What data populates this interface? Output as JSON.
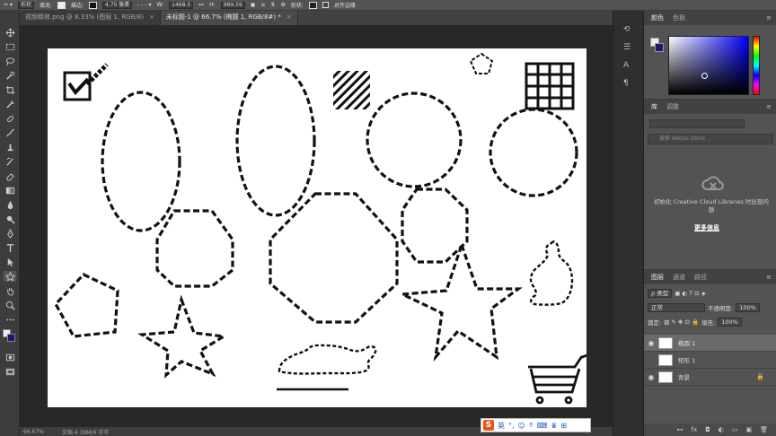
{
  "options_bar": {
    "shape_mode": "形状",
    "fill_label": "填充:",
    "stroke_label": "描边:",
    "stroke_width": "4.75 像素",
    "w_label": "W:",
    "w_value": "1468.5",
    "h_label": "H:",
    "h_value": "989.59",
    "shape_label": "形状:",
    "align_edges": "对齐边缘"
  },
  "tabs": [
    {
      "label": "视频精修.png @ 8.33% (图层 1, RGB/8)",
      "close": "×"
    },
    {
      "label": "未标题-1 @ 66.7% (椭圆 1, RGB/8#) *",
      "close": "×"
    }
  ],
  "status": {
    "zoom": "66.67%",
    "doc": "文档:4.39M/0 字节"
  },
  "ime": {
    "logo": "S",
    "mode": "英"
  },
  "color_panel": {
    "tabs": [
      "颜色",
      "色板"
    ],
    "fg_color": "#eeeeee",
    "bg_color": "#1a1a6a"
  },
  "libraries": {
    "tabs": [
      "库",
      "调整"
    ],
    "search_placeholder": "搜索 Adobe Stock",
    "init_text": "初始化 Creative Cloud Libraries 时出现问题",
    "more_info": "更多信息"
  },
  "layers": {
    "tabs": [
      "图层",
      "通道",
      "路径"
    ],
    "kind_filter": "ρ 类型",
    "blend_mode": "正常",
    "opacity_label": "不透明度:",
    "opacity": "100%",
    "lock_label": "锁定:",
    "fill_label": "填充:",
    "fill": "100%",
    "items": [
      {
        "name": "椭圆 1",
        "visible": true,
        "selected": true
      },
      {
        "name": "矩形 1",
        "visible": false,
        "selected": false
      },
      {
        "name": "背景",
        "visible": true,
        "selected": false,
        "locked": true
      }
    ],
    "bottom_icons": [
      "link",
      "fx",
      "mask",
      "adjust",
      "folder",
      "new",
      "trash"
    ]
  }
}
